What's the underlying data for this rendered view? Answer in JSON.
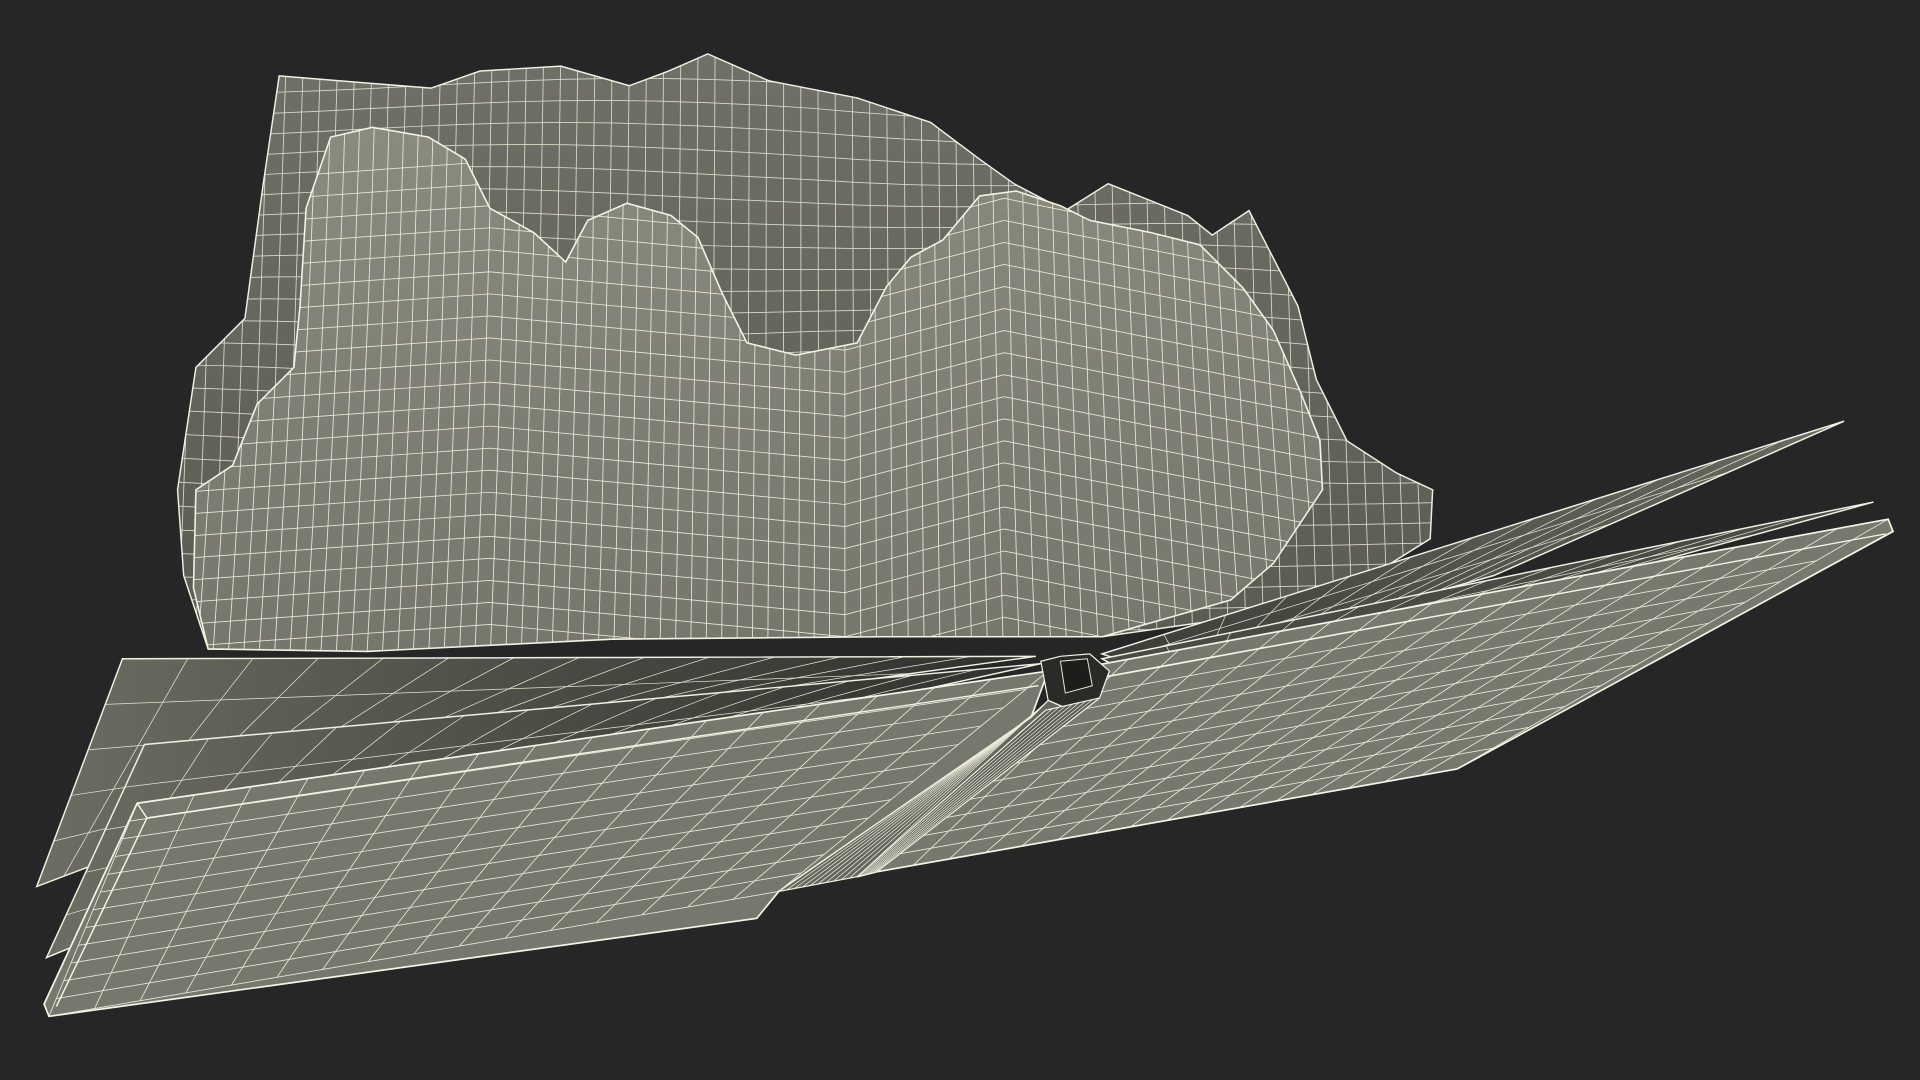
{
  "scene": {
    "subject": "wireframe-render",
    "colors": {
      "background": "#262626",
      "mesh_fill": "#7b7b70",
      "mesh_fill_shadow": "#5d5e55",
      "mesh_fill_light": "#8a8a7e",
      "page_fill": "#707066",
      "page_fill_dark": "#3a3b36",
      "wire": "#e6e6d6",
      "wire_strong": "#f4f4e6"
    }
  }
}
